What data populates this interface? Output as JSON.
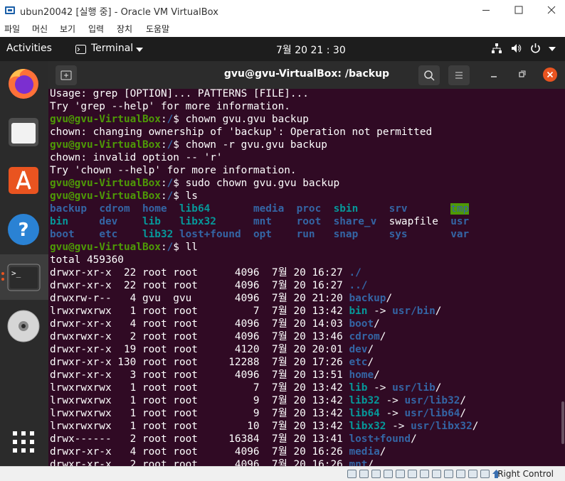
{
  "window": {
    "title": "ubun20042 [실행 중] - Oracle VM VirtualBox"
  },
  "menu": [
    "파일",
    "머신",
    "보기",
    "입력",
    "장치",
    "도움말"
  ],
  "topbar": {
    "activities": "Activities",
    "app": "Terminal",
    "clock": "7월 20  21 : 30"
  },
  "terminal": {
    "title": "gvu@gvu-VirtualBox: /backup",
    "prompt_user": "gvu@gvu-VirtualBox",
    "lines": [
      [
        {
          "t": "Usage: grep [OPTION]... PATTERNS [FILE]..."
        }
      ],
      [
        {
          "t": "Try 'grep --help' for more information."
        }
      ],
      [
        {
          "t": "gvu@gvu-VirtualBox",
          "c": "grn"
        },
        {
          "t": ":"
        },
        {
          "t": "/",
          "c": "blu"
        },
        {
          "t": "$ chown gvu.gvu backup"
        }
      ],
      [
        {
          "t": "chown: changing ownership of 'backup': Operation not permitted"
        }
      ],
      [
        {
          "t": "gvu@gvu-VirtualBox",
          "c": "grn"
        },
        {
          "t": ":"
        },
        {
          "t": "/",
          "c": "blu"
        },
        {
          "t": "$ chown -r gvu.gvu backup"
        }
      ],
      [
        {
          "t": "chown: invalid option -- 'r'"
        }
      ],
      [
        {
          "t": "Try 'chown --help' for more information."
        }
      ],
      [
        {
          "t": "gvu@gvu-VirtualBox",
          "c": "grn"
        },
        {
          "t": ":"
        },
        {
          "t": "/",
          "c": "blu"
        },
        {
          "t": "$ sudo chown gvu.gvu backup"
        }
      ],
      [
        {
          "t": "gvu@gvu-VirtualBox",
          "c": "grn"
        },
        {
          "t": ":"
        },
        {
          "t": "/",
          "c": "blu"
        },
        {
          "t": "$ ls"
        }
      ],
      [
        {
          "t": "backup",
          "c": "blu"
        },
        {
          "t": "  "
        },
        {
          "t": "cdrom",
          "c": "blu"
        },
        {
          "t": "  "
        },
        {
          "t": "home",
          "c": "blu"
        },
        {
          "t": "  "
        },
        {
          "t": "lib64",
          "c": "cyn"
        },
        {
          "t": "       "
        },
        {
          "t": "media",
          "c": "blu"
        },
        {
          "t": "  "
        },
        {
          "t": "proc",
          "c": "blu"
        },
        {
          "t": "  "
        },
        {
          "t": "sbin",
          "c": "cyn"
        },
        {
          "t": "     "
        },
        {
          "t": "srv",
          "c": "blu"
        },
        {
          "t": "       "
        },
        {
          "t": "tmp",
          "c": "tmp"
        }
      ],
      [
        {
          "t": "bin",
          "c": "cyn"
        },
        {
          "t": "     "
        },
        {
          "t": "dev",
          "c": "blu"
        },
        {
          "t": "    "
        },
        {
          "t": "lib",
          "c": "cyn"
        },
        {
          "t": "   "
        },
        {
          "t": "libx32",
          "c": "cyn"
        },
        {
          "t": "      "
        },
        {
          "t": "mnt",
          "c": "blu"
        },
        {
          "t": "    "
        },
        {
          "t": "root",
          "c": "blu"
        },
        {
          "t": "  "
        },
        {
          "t": "share_v",
          "c": "blu"
        },
        {
          "t": "  "
        },
        {
          "t": "swapfile"
        },
        {
          "t": "  "
        },
        {
          "t": "usr",
          "c": "blu"
        }
      ],
      [
        {
          "t": "boot",
          "c": "blu"
        },
        {
          "t": "    "
        },
        {
          "t": "etc",
          "c": "blu"
        },
        {
          "t": "    "
        },
        {
          "t": "lib32",
          "c": "cyn"
        },
        {
          "t": " "
        },
        {
          "t": "lost+found",
          "c": "blu"
        },
        {
          "t": "  "
        },
        {
          "t": "opt",
          "c": "blu"
        },
        {
          "t": "    "
        },
        {
          "t": "run",
          "c": "blu"
        },
        {
          "t": "   "
        },
        {
          "t": "snap",
          "c": "blu"
        },
        {
          "t": "     "
        },
        {
          "t": "sys",
          "c": "blu"
        },
        {
          "t": "       "
        },
        {
          "t": "var",
          "c": "blu"
        }
      ],
      [
        {
          "t": "gvu@gvu-VirtualBox",
          "c": "grn"
        },
        {
          "t": ":"
        },
        {
          "t": "/",
          "c": "blu"
        },
        {
          "t": "$ ll"
        }
      ],
      [
        {
          "t": "total 459360"
        }
      ],
      [
        {
          "t": "drwxr-xr-x  22 root root      4096  7월 20 16:27 "
        },
        {
          "t": "./",
          "c": "blu"
        }
      ],
      [
        {
          "t": "drwxr-xr-x  22 root root      4096  7월 20 16:27 "
        },
        {
          "t": "../",
          "c": "blu"
        }
      ],
      [
        {
          "t": "drwxrw-r--   4 gvu  gvu       4096  7월 20 21:20 "
        },
        {
          "t": "backup",
          "c": "blu"
        },
        {
          "t": "/"
        }
      ],
      [
        {
          "t": "lrwxrwxrwx   1 root root         7  7월 20 13:42 "
        },
        {
          "t": "bin",
          "c": "cyn"
        },
        {
          "t": " -> "
        },
        {
          "t": "usr/bin",
          "c": "blu"
        },
        {
          "t": "/"
        }
      ],
      [
        {
          "t": "drwxr-xr-x   4 root root      4096  7월 20 14:03 "
        },
        {
          "t": "boot",
          "c": "blu"
        },
        {
          "t": "/"
        }
      ],
      [
        {
          "t": "drwxrwxr-x   2 root root      4096  7월 20 13:46 "
        },
        {
          "t": "cdrom",
          "c": "blu"
        },
        {
          "t": "/"
        }
      ],
      [
        {
          "t": "drwxr-xr-x  19 root root      4120  7월 20 20:01 "
        },
        {
          "t": "dev",
          "c": "blu"
        },
        {
          "t": "/"
        }
      ],
      [
        {
          "t": "drwxr-xr-x 130 root root     12288  7월 20 17:26 "
        },
        {
          "t": "etc",
          "c": "blu"
        },
        {
          "t": "/"
        }
      ],
      [
        {
          "t": "drwxr-xr-x   3 root root      4096  7월 20 13:51 "
        },
        {
          "t": "home",
          "c": "blu"
        },
        {
          "t": "/"
        }
      ],
      [
        {
          "t": "lrwxrwxrwx   1 root root         7  7월 20 13:42 "
        },
        {
          "t": "lib",
          "c": "cyn"
        },
        {
          "t": " -> "
        },
        {
          "t": "usr/lib",
          "c": "blu"
        },
        {
          "t": "/"
        }
      ],
      [
        {
          "t": "lrwxrwxrwx   1 root root         9  7월 20 13:42 "
        },
        {
          "t": "lib32",
          "c": "cyn"
        },
        {
          "t": " -> "
        },
        {
          "t": "usr/lib32",
          "c": "blu"
        },
        {
          "t": "/"
        }
      ],
      [
        {
          "t": "lrwxrwxrwx   1 root root         9  7월 20 13:42 "
        },
        {
          "t": "lib64",
          "c": "cyn"
        },
        {
          "t": " -> "
        },
        {
          "t": "usr/lib64",
          "c": "blu"
        },
        {
          "t": "/"
        }
      ],
      [
        {
          "t": "lrwxrwxrwx   1 root root        10  7월 20 13:42 "
        },
        {
          "t": "libx32",
          "c": "cyn"
        },
        {
          "t": " -> "
        },
        {
          "t": "usr/libx32",
          "c": "blu"
        },
        {
          "t": "/"
        }
      ],
      [
        {
          "t": "drwx------   2 root root     16384  7월 20 13:41 "
        },
        {
          "t": "lost+found",
          "c": "blu"
        },
        {
          "t": "/"
        }
      ],
      [
        {
          "t": "drwxr-xr-x   4 root root      4096  7월 20 16:26 "
        },
        {
          "t": "media",
          "c": "blu"
        },
        {
          "t": "/"
        }
      ],
      [
        {
          "t": "drwxr-xr-x   2 root root      4096  7월 20 16:26 "
        },
        {
          "t": "mnt",
          "c": "blu"
        },
        {
          "t": "/"
        }
      ]
    ]
  },
  "statusbar": {
    "host_key": "Right Control"
  },
  "colors": {
    "terminal_bg": "#300a24",
    "prompt_green": "#4e9a06",
    "dir_blue": "#3465a4",
    "link_cyan": "#06989a",
    "topbar": "#1d1d1d"
  },
  "icons": [
    "virtualbox-icon",
    "minimize-icon",
    "maximize-icon",
    "close-icon",
    "terminal-icon",
    "caret-down-icon",
    "network-icon",
    "volume-icon",
    "power-icon",
    "firefox-icon",
    "files-icon",
    "software-icon",
    "help-icon",
    "disc-icon",
    "apps-grid-icon",
    "new-tab-icon",
    "search-icon",
    "hamburger-icon"
  ]
}
